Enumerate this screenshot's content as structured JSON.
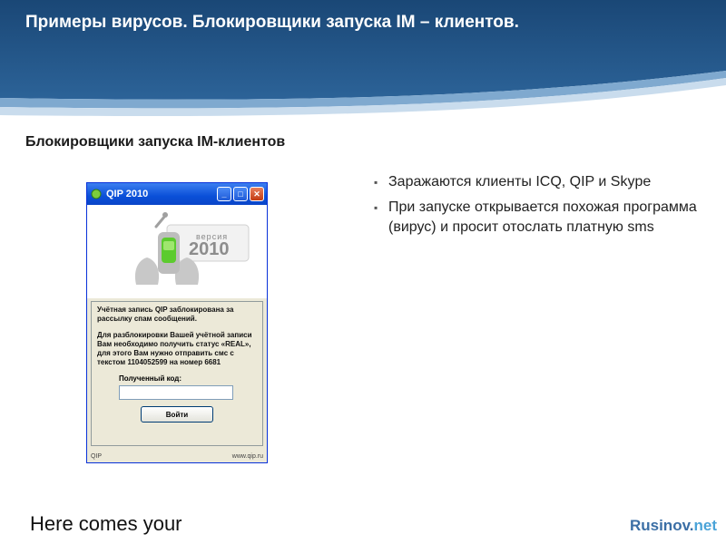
{
  "slide": {
    "title": "Примеры вирусов. Блокировщики запуска IM – клиентов.",
    "subtitle": "Блокировщики запуска IM-клиентов",
    "bullets": [
      "Заражаются клиенты ICQ, QIP и Skype",
      "При запуске открывается похожая программа (вирус) и просит отослать платную sms"
    ],
    "footer_text": "Here comes your",
    "brand_part1": "Rusinov.",
    "brand_part2": "net"
  },
  "window": {
    "title": "QIP 2010",
    "minimize_glyph": "_",
    "maximize_glyph": "□",
    "close_glyph": "✕",
    "logo_version_label": "версия",
    "logo_version_year": "2010",
    "message_1": "Учётная запись QIP заблокирована за рассылку спам сообщений.",
    "message_2": "Для разблокировки Вашей учётной записи Вам необходимо получить статус «REAL», для этого Вам нужно отправить смс с текстом 1104052599 на номер 6681",
    "code_label": "Полученный код:",
    "code_value": "",
    "enter_button": "Войти",
    "status_left": "QIP",
    "status_right": "www.qip.ru"
  },
  "colors": {
    "header_dark": "#1f4f7d",
    "header_light": "#6ea0c8",
    "brand_blue": "#3a6ea5",
    "brand_light": "#4aa3d8",
    "xp_title": "#0a4fd8"
  }
}
